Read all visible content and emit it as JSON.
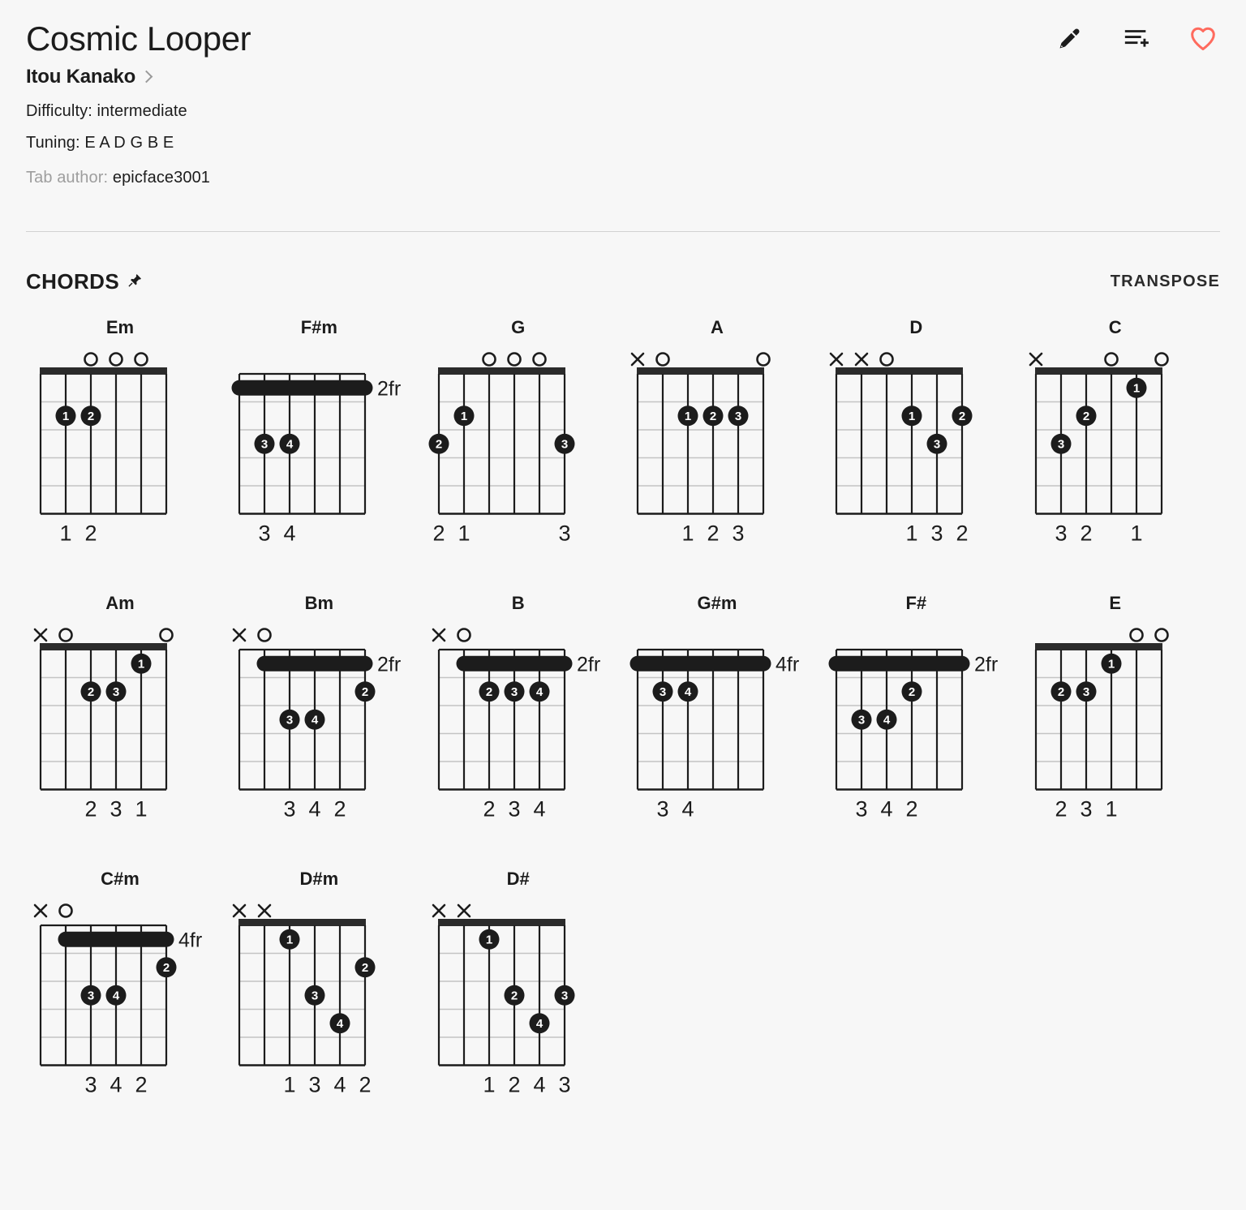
{
  "header": {
    "title": "Cosmic Looper",
    "artist": "Itou Kanako",
    "artist_chevron_icon": "chevron-right-icon",
    "difficulty": "Difficulty: intermediate",
    "tuning": "Tuning: E A D G B E",
    "tab_author_label": "Tab author:",
    "tab_author_value": "epicface3001",
    "actions": [
      {
        "name": "edit-icon",
        "label": "Edit"
      },
      {
        "name": "playlist-add-icon",
        "label": "Add to playlist"
      },
      {
        "name": "favorite-heart-icon",
        "label": "Favorite",
        "color": "#ff6b5e"
      }
    ]
  },
  "chords_section": {
    "title": "CHORDS",
    "pin_icon": "pin-icon",
    "transpose_label": "TRANSPOSE"
  },
  "colors": {
    "background": "#f7f7f7",
    "ink": "#1c1c1c",
    "muted": "#9e9e9e",
    "divider": "#d2d2d2",
    "fret_line": "#bdbdbd",
    "accent_heart": "#ff6b5e"
  },
  "chords": [
    {
      "name": "Em",
      "position_label": "",
      "markers": [
        "",
        "",
        "o",
        "o",
        "o",
        ""
      ],
      "barre": null,
      "nut": true,
      "dots": [
        {
          "string": 1,
          "fret": 2,
          "finger": "1"
        },
        {
          "string": 2,
          "fret": 2,
          "finger": "2"
        }
      ],
      "fingers_below": [
        "",
        "1",
        "2",
        "",
        "",
        ""
      ]
    },
    {
      "name": "F#m",
      "position_label": "2fr",
      "markers": [
        "",
        "",
        "",
        "",
        "",
        ""
      ],
      "barre": {
        "from": 0,
        "to": 5,
        "fret": 1
      },
      "nut": false,
      "dots": [
        {
          "string": 1,
          "fret": 3,
          "finger": "3"
        },
        {
          "string": 2,
          "fret": 3,
          "finger": "4"
        }
      ],
      "fingers_below": [
        "",
        "3",
        "4",
        "",
        "",
        ""
      ]
    },
    {
      "name": "G",
      "position_label": "",
      "markers": [
        "",
        "",
        "o",
        "o",
        "o",
        ""
      ],
      "barre": null,
      "nut": true,
      "dots": [
        {
          "string": 0,
          "fret": 3,
          "finger": "2"
        },
        {
          "string": 1,
          "fret": 2,
          "finger": "1"
        },
        {
          "string": 5,
          "fret": 3,
          "finger": "3"
        }
      ],
      "fingers_below": [
        "2",
        "1",
        "",
        "",
        "",
        "3"
      ]
    },
    {
      "name": "A",
      "position_label": "",
      "markers": [
        "x",
        "o",
        "",
        "",
        "",
        "o"
      ],
      "barre": null,
      "nut": true,
      "dots": [
        {
          "string": 2,
          "fret": 2,
          "finger": "1"
        },
        {
          "string": 3,
          "fret": 2,
          "finger": "2"
        },
        {
          "string": 4,
          "fret": 2,
          "finger": "3"
        }
      ],
      "fingers_below": [
        "",
        "",
        "1",
        "2",
        "3",
        ""
      ]
    },
    {
      "name": "D",
      "position_label": "",
      "markers": [
        "x",
        "x",
        "o",
        "",
        "",
        ""
      ],
      "barre": null,
      "nut": true,
      "dots": [
        {
          "string": 3,
          "fret": 2,
          "finger": "1"
        },
        {
          "string": 5,
          "fret": 2,
          "finger": "2"
        },
        {
          "string": 4,
          "fret": 3,
          "finger": "3"
        }
      ],
      "fingers_below": [
        "",
        "",
        "",
        "1",
        "3",
        "2"
      ]
    },
    {
      "name": "C",
      "position_label": "",
      "markers": [
        "x",
        "",
        "",
        "o",
        "",
        "o"
      ],
      "barre": null,
      "nut": true,
      "dots": [
        {
          "string": 4,
          "fret": 1,
          "finger": "1"
        },
        {
          "string": 2,
          "fret": 2,
          "finger": "2"
        },
        {
          "string": 1,
          "fret": 3,
          "finger": "3"
        }
      ],
      "fingers_below": [
        "",
        "3",
        "2",
        "",
        "1",
        ""
      ]
    },
    {
      "name": "Am",
      "position_label": "",
      "markers": [
        "x",
        "o",
        "",
        "",
        "",
        "o"
      ],
      "barre": null,
      "nut": true,
      "dots": [
        {
          "string": 4,
          "fret": 1,
          "finger": "1"
        },
        {
          "string": 2,
          "fret": 2,
          "finger": "2"
        },
        {
          "string": 3,
          "fret": 2,
          "finger": "3"
        }
      ],
      "fingers_below": [
        "",
        "",
        "2",
        "3",
        "1",
        ""
      ]
    },
    {
      "name": "Bm",
      "position_label": "2fr",
      "markers": [
        "x",
        "o",
        "",
        "",
        "",
        ""
      ],
      "barre": {
        "from": 1,
        "to": 5,
        "fret": 1
      },
      "nut": false,
      "dots": [
        {
          "string": 5,
          "fret": 2,
          "finger": "2"
        },
        {
          "string": 2,
          "fret": 3,
          "finger": "3"
        },
        {
          "string": 3,
          "fret": 3,
          "finger": "4"
        }
      ],
      "fingers_below": [
        "",
        "",
        "3",
        "4",
        "2",
        ""
      ]
    },
    {
      "name": "B",
      "position_label": "2fr",
      "markers": [
        "x",
        "o",
        "",
        "",
        "",
        ""
      ],
      "barre": {
        "from": 1,
        "to": 5,
        "fret": 1
      },
      "nut": false,
      "dots": [
        {
          "string": 2,
          "fret": 2,
          "finger": "2"
        },
        {
          "string": 3,
          "fret": 2,
          "finger": "3"
        },
        {
          "string": 4,
          "fret": 2,
          "finger": "4"
        }
      ],
      "fingers_below": [
        "",
        "",
        "2",
        "3",
        "4",
        ""
      ]
    },
    {
      "name": "G#m",
      "position_label": "4fr",
      "markers": [
        "",
        "",
        "",
        "",
        "",
        ""
      ],
      "barre": {
        "from": 0,
        "to": 5,
        "fret": 1
      },
      "nut": false,
      "dots": [
        {
          "string": 1,
          "fret": 2,
          "finger": "3"
        },
        {
          "string": 2,
          "fret": 2,
          "finger": "4"
        }
      ],
      "fingers_below": [
        "",
        "3",
        "4",
        "",
        "",
        ""
      ]
    },
    {
      "name": "F#",
      "position_label": "2fr",
      "markers": [
        "",
        "",
        "",
        "",
        "",
        ""
      ],
      "barre": {
        "from": 0,
        "to": 5,
        "fret": 1
      },
      "nut": false,
      "dots": [
        {
          "string": 3,
          "fret": 2,
          "finger": "2"
        },
        {
          "string": 1,
          "fret": 3,
          "finger": "3"
        },
        {
          "string": 2,
          "fret": 3,
          "finger": "4"
        }
      ],
      "fingers_below": [
        "",
        "3",
        "4",
        "2",
        "",
        ""
      ]
    },
    {
      "name": "E",
      "position_label": "",
      "markers": [
        "",
        "",
        "",
        "",
        "o",
        "o"
      ],
      "barre": null,
      "nut": true,
      "dots": [
        {
          "string": 3,
          "fret": 1,
          "finger": "1"
        },
        {
          "string": 1,
          "fret": 2,
          "finger": "2"
        },
        {
          "string": 2,
          "fret": 2,
          "finger": "3"
        }
      ],
      "fingers_below": [
        "",
        "2",
        "3",
        "1",
        "",
        ""
      ]
    },
    {
      "name": "C#m",
      "position_label": "4fr",
      "markers": [
        "x",
        "o",
        "",
        "",
        "",
        ""
      ],
      "barre": {
        "from": 1,
        "to": 5,
        "fret": 1
      },
      "nut": false,
      "dots": [
        {
          "string": 5,
          "fret": 2,
          "finger": "2"
        },
        {
          "string": 2,
          "fret": 3,
          "finger": "3"
        },
        {
          "string": 3,
          "fret": 3,
          "finger": "4"
        }
      ],
      "fingers_below": [
        "",
        "",
        "3",
        "4",
        "2",
        ""
      ]
    },
    {
      "name": "D#m",
      "position_label": "",
      "markers": [
        "x",
        "x",
        "",
        "",
        "",
        ""
      ],
      "barre": null,
      "nut": true,
      "dots": [
        {
          "string": 2,
          "fret": 1,
          "finger": "1"
        },
        {
          "string": 5,
          "fret": 2,
          "finger": "2"
        },
        {
          "string": 3,
          "fret": 3,
          "finger": "3"
        },
        {
          "string": 4,
          "fret": 4,
          "finger": "4"
        }
      ],
      "fingers_below": [
        "",
        "",
        "1",
        "3",
        "4",
        "2"
      ]
    },
    {
      "name": "D#",
      "position_label": "",
      "markers": [
        "x",
        "x",
        "",
        "",
        "",
        ""
      ],
      "barre": null,
      "nut": true,
      "dots": [
        {
          "string": 2,
          "fret": 1,
          "finger": "1"
        },
        {
          "string": 3,
          "fret": 3,
          "finger": "2"
        },
        {
          "string": 5,
          "fret": 3,
          "finger": "3"
        },
        {
          "string": 4,
          "fret": 4,
          "finger": "4"
        }
      ],
      "fingers_below": [
        "",
        "",
        "1",
        "2",
        "4",
        "3"
      ]
    }
  ]
}
